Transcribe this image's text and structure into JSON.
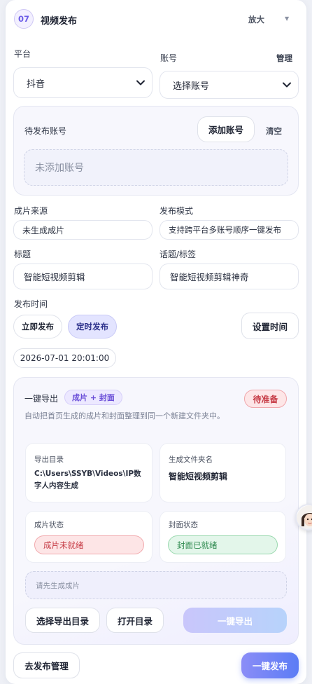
{
  "header": {
    "step_number": "07",
    "title": "视频发布",
    "zoom_label": "放大"
  },
  "platform": {
    "label": "平台",
    "value": "抖音"
  },
  "account": {
    "label": "账号",
    "manage_label": "管理",
    "value": "选择账号"
  },
  "pending": {
    "label": "待发布账号",
    "add_button": "添加账号",
    "clear_button": "清空",
    "empty_text": "未添加账号"
  },
  "source": {
    "label": "成片来源",
    "value": "未生成成片"
  },
  "mode": {
    "label": "发布模式",
    "value": "支持跨平台多账号顺序一键发布"
  },
  "title_field": {
    "label": "标题",
    "value": "智能短视频剪辑"
  },
  "tags_field": {
    "label": "话题/标签",
    "value": "智能短视频剪辑神奇"
  },
  "publish_time": {
    "label": "发布时间",
    "now_button": "立即发布",
    "scheduled_button": "定时发布",
    "set_time_button": "设置时间",
    "datetime": "2026-07-01 20:01:00"
  },
  "export": {
    "title": "一键导出",
    "badge": "成片 + 封面",
    "status": "待准备",
    "description": "自动把首页生成的成片和封面整理到同一个新建文件夹中。",
    "dir_label": "导出目录",
    "dir_value": "C:\\Users\\SSYB\\Videos\\IP数字人内容生成",
    "folder_label": "生成文件夹名",
    "folder_value": "智能短视频剪辑",
    "clip_status_label": "成片状态",
    "clip_status_value": "成片未就绪",
    "cover_status_label": "封面状态",
    "cover_status_value": "封面已就绪",
    "hint": "请先生成成片",
    "choose_dir_button": "选择导出目录",
    "open_dir_button": "打开目录",
    "export_button": "一键导出"
  },
  "footer": {
    "manage_button": "去发布管理",
    "publish_button": "一键发布"
  },
  "colors": {
    "accent": "#6b5ce7",
    "primary_gradient_start": "#8b8df7",
    "primary_gradient_end": "#5b7cf5"
  }
}
